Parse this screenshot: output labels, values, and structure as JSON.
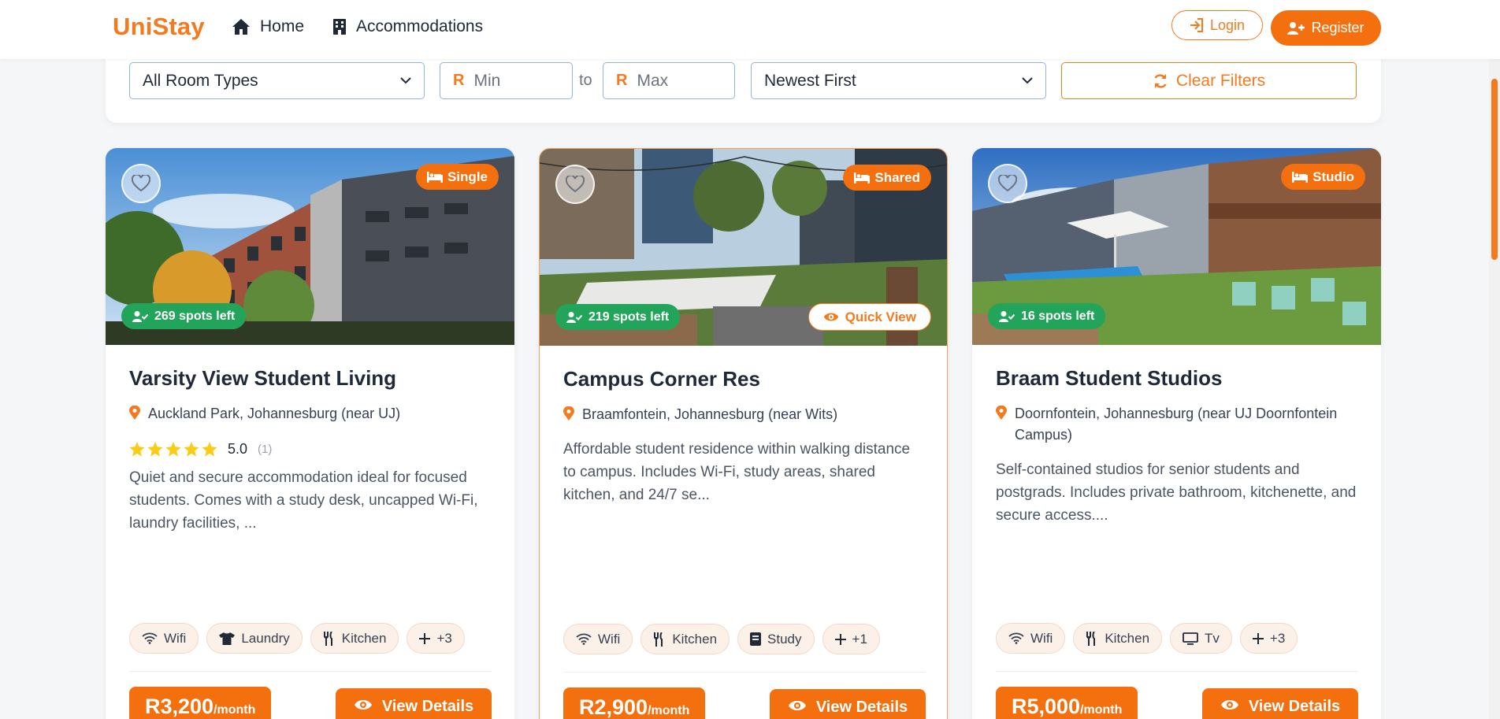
{
  "navbar": {
    "brand": "UniStay",
    "links": [
      {
        "label": "Home",
        "icon": "home-icon"
      },
      {
        "label": "Accommodations",
        "icon": "building-icon"
      }
    ],
    "login_label": "Login",
    "register_label": "Register"
  },
  "filters": {
    "room_type": "All Room Types",
    "currency_symbol": "R",
    "min_placeholder": "Min",
    "to_label": "to",
    "max_placeholder": "Max",
    "sort": "Newest First",
    "clear_label": "Clear Filters"
  },
  "cards": [
    {
      "type": "Single",
      "spots": "269 spots left",
      "title": "Varsity View Student Living",
      "location": "Auckland Park, Johannesburg (near UJ)",
      "rating": "5.0",
      "rating_count": "(1)",
      "description": "Quiet and secure accommodation ideal for focused students. Comes with a study desk, uncapped Wi-Fi, laundry facilities, ...",
      "amenities": [
        {
          "label": "Wifi",
          "icon": "wifi-icon"
        },
        {
          "label": "Laundry",
          "icon": "shirt-icon"
        },
        {
          "label": "Kitchen",
          "icon": "utensils-icon"
        },
        {
          "label": "+3",
          "icon": "plus-icon"
        }
      ],
      "price": "R3,200",
      "price_unit": "/month",
      "view_label": "View Details"
    },
    {
      "type": "Shared",
      "spots": "219 spots left",
      "quick_view": "Quick View",
      "title": "Campus Corner Res",
      "location": "Braamfontein, Johannesburg (near Wits)",
      "description": "Affordable student residence within walking distance to campus. Includes Wi-Fi, study areas, shared kitchen, and 24/7 se...",
      "amenities": [
        {
          "label": "Wifi",
          "icon": "wifi-icon"
        },
        {
          "label": "Kitchen",
          "icon": "utensils-icon"
        },
        {
          "label": "Study",
          "icon": "book-icon"
        },
        {
          "label": "+1",
          "icon": "plus-icon"
        }
      ],
      "price": "R2,900",
      "price_unit": "/month",
      "view_label": "View Details"
    },
    {
      "type": "Studio",
      "spots": "16 spots left",
      "title": "Braam Student Studios",
      "location": "Doornfontein, Johannesburg (near UJ Doornfontein Campus)",
      "description": "Self-contained studios for senior students and postgrads. Includes private bathroom, kitchenette, and secure access....",
      "amenities": [
        {
          "label": "Wifi",
          "icon": "wifi-icon"
        },
        {
          "label": "Kitchen",
          "icon": "utensils-icon"
        },
        {
          "label": "Tv",
          "icon": "tv-icon"
        },
        {
          "label": "+3",
          "icon": "plus-icon"
        }
      ],
      "price": "R5,000",
      "price_unit": "/month",
      "view_label": "View Details"
    }
  ],
  "colors": {
    "accent": "#f47a1f",
    "success": "#22a55a",
    "star": "#facc15"
  }
}
